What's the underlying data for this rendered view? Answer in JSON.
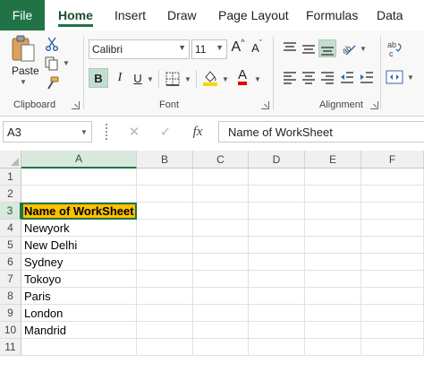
{
  "ribbon_tabs": [
    {
      "label": "File"
    },
    {
      "label": "Home"
    },
    {
      "label": "Insert"
    },
    {
      "label": "Draw"
    },
    {
      "label": "Page Layout"
    },
    {
      "label": "Formulas"
    },
    {
      "label": "Data"
    }
  ],
  "active_tab": "Home",
  "clipboard": {
    "paste_label": "Paste",
    "group_label": "Clipboard",
    "icons": [
      "paste-icon",
      "cut-icon",
      "copy-icon",
      "format-painter-icon"
    ]
  },
  "font": {
    "font_name": "Calibri",
    "font_size": "11",
    "bold_label": "B",
    "italic_label": "I",
    "underline_label": "U",
    "grow_label": "A",
    "shrink_label": "A",
    "font_color_label": "A",
    "group_label": "Font",
    "fill_color": "#ffd400",
    "font_color": "#e00000"
  },
  "alignment": {
    "group_label": "Alignment"
  },
  "formula_bar": {
    "name_box": "A3",
    "fx_label": "fx",
    "formula_value": "Name of WorkSheet"
  },
  "sheet": {
    "columns": [
      "A",
      "B",
      "C",
      "D",
      "E",
      "F"
    ],
    "rows": [
      "1",
      "2",
      "3",
      "4",
      "5",
      "6",
      "7",
      "8",
      "9",
      "10",
      "11"
    ],
    "cells_a": [
      "",
      "",
      "Name of WorkSheet",
      "Newyork",
      "New Delhi",
      "Sydney",
      "Tokoyo",
      "Paris",
      "London",
      "Mandrid",
      ""
    ],
    "active_cell": "A3",
    "active_fill": "#ffc000"
  },
  "colors": {
    "accent": "#217346",
    "header_bg": "#f0f0f0"
  }
}
